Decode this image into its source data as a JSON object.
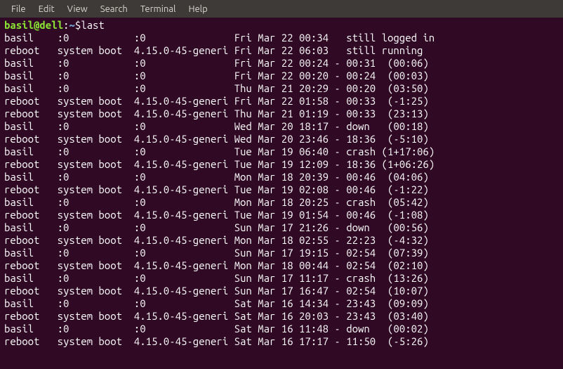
{
  "menubar": {
    "items": [
      "File",
      "Edit",
      "View",
      "Search",
      "Terminal",
      "Help"
    ]
  },
  "prompt": {
    "user_host": "basil@dell",
    "colon": ":",
    "path": "~",
    "dollar": "$ ",
    "command": "last"
  },
  "output": [
    "basil    :0           :0               Fri Mar 22 00:34   still logged in",
    "reboot   system boot  4.15.0-45-generi Fri Mar 22 06:03   still running",
    "basil    :0           :0               Fri Mar 22 00:24 - 00:31  (00:06)",
    "basil    :0           :0               Fri Mar 22 00:20 - 00:24  (00:03)",
    "basil    :0           :0               Thu Mar 21 20:29 - 00:20  (03:50)",
    "reboot   system boot  4.15.0-45-generi Fri Mar 22 01:58 - 00:33  (-1:25)",
    "reboot   system boot  4.15.0-45-generi Thu Mar 21 01:19 - 00:33  (23:13)",
    "basil    :0           :0               Wed Mar 20 18:17 - down   (00:18)",
    "reboot   system boot  4.15.0-45-generi Wed Mar 20 23:46 - 18:36  (-5:10)",
    "basil    :0           :0               Tue Mar 19 06:40 - crash (1+17:06)",
    "reboot   system boot  4.15.0-45-generi Tue Mar 19 12:09 - 18:36 (1+06:26)",
    "basil    :0           :0               Mon Mar 18 20:39 - 00:46  (04:06)",
    "reboot   system boot  4.15.0-45-generi Tue Mar 19 02:08 - 00:46  (-1:22)",
    "basil    :0           :0               Mon Mar 18 20:25 - crash  (05:42)",
    "reboot   system boot  4.15.0-45-generi Tue Mar 19 01:54 - 00:46  (-1:08)",
    "basil    :0           :0               Sun Mar 17 21:26 - down   (00:56)",
    "reboot   system boot  4.15.0-45-generi Mon Mar 18 02:55 - 22:23  (-4:32)",
    "basil    :0           :0               Sun Mar 17 19:15 - 02:54  (07:39)",
    "reboot   system boot  4.15.0-45-generi Mon Mar 18 00:44 - 02:54  (02:10)",
    "basil    :0           :0               Sun Mar 17 11:17 - crash  (13:26)",
    "reboot   system boot  4.15.0-45-generi Sun Mar 17 16:47 - 02:54  (10:07)",
    "basil    :0           :0               Sat Mar 16 14:34 - 23:43  (09:09)",
    "reboot   system boot  4.15.0-45-generi Sat Mar 16 20:03 - 23:43  (03:40)",
    "basil    :0           :0               Sat Mar 16 11:48 - down   (00:02)",
    "reboot   system boot  4.15.0-45-generi Sat Mar 16 17:17 - 11:50  (-5:26)"
  ]
}
